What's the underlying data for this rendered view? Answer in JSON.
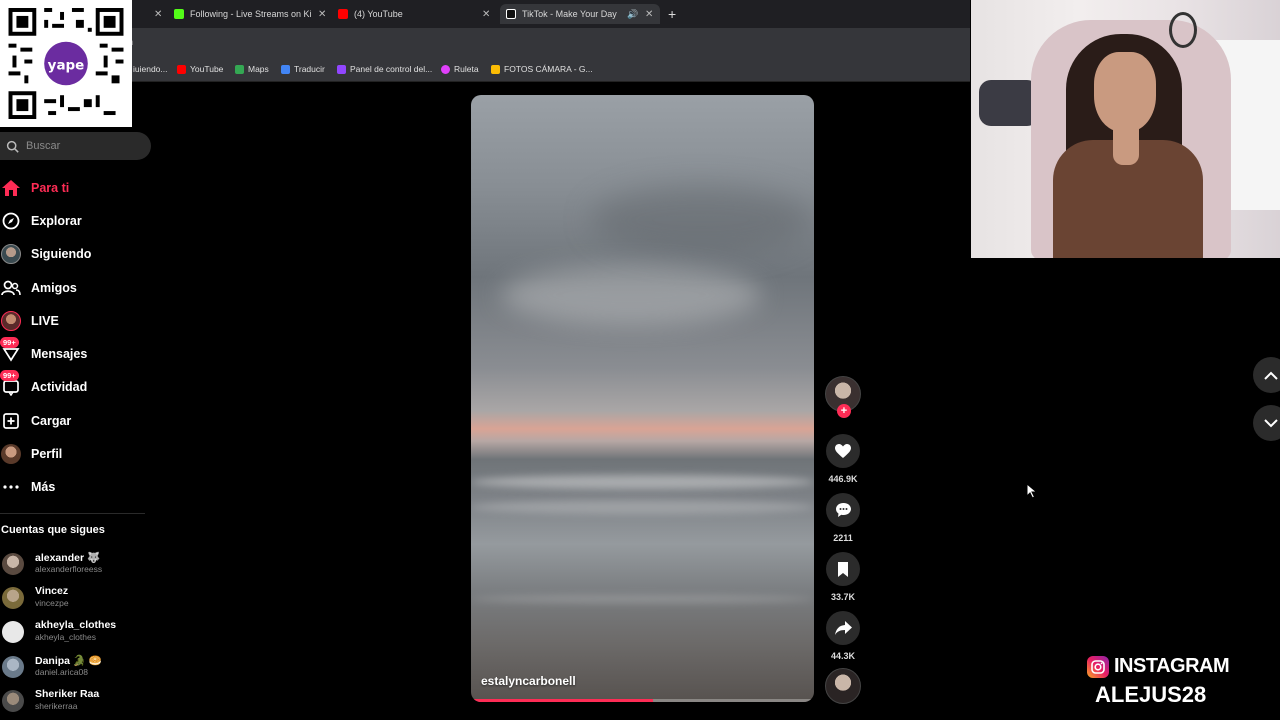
{
  "browser": {
    "tabs": [
      {
        "title": "",
        "icon": "tab-icon",
        "color": "#888888"
      },
      {
        "title": "Following - Live Streams on Ki",
        "icon": "kick-icon",
        "color": "#53fc18"
      },
      {
        "title": "(4) YouTube",
        "icon": "youtube-icon",
        "color": "#ff0000"
      },
      {
        "title": "TikTok - Make Your Day",
        "icon": "tiktok-icon",
        "color": "#ffffff"
      }
    ],
    "address_fragment": "n",
    "bookmarks": [
      {
        "label": "iuiendo...",
        "color": "#9146ff"
      },
      {
        "label": "YouTube",
        "color": "#ff0000"
      },
      {
        "label": "Maps",
        "color": "#34a853"
      },
      {
        "label": "Traducir",
        "color": "#4285f4"
      },
      {
        "label": "Panel de control del...",
        "color": "#9146ff"
      },
      {
        "label": "Ruleta",
        "color": "#e040fb"
      },
      {
        "label": "FOTOS CÁMARA - G...",
        "color": "#fbbc04"
      }
    ]
  },
  "sidebar": {
    "search_placeholder": "Buscar",
    "nav": [
      {
        "label": "Para ti",
        "icon": "home-icon",
        "active": true
      },
      {
        "label": "Explorar",
        "icon": "compass-icon"
      },
      {
        "label": "Siguiendo",
        "icon": "following-avatar-icon"
      },
      {
        "label": "Amigos",
        "icon": "friends-icon"
      },
      {
        "label": "LIVE",
        "icon": "live-avatar-icon"
      },
      {
        "label": "Mensajes",
        "icon": "messages-icon",
        "badge": "99+"
      },
      {
        "label": "Actividad",
        "icon": "activity-icon",
        "badge": "99+"
      },
      {
        "label": "Cargar",
        "icon": "upload-icon"
      },
      {
        "label": "Perfil",
        "icon": "profile-avatar-icon"
      },
      {
        "label": "Más",
        "icon": "more-icon"
      }
    ],
    "following_title": "Cuentas que sigues",
    "accounts": [
      {
        "name": "alexander 🐺",
        "handle": "alexanderfloreess",
        "color": "#5a4a40"
      },
      {
        "name": "Vincez",
        "handle": "vincezpe",
        "color": "#7a6a3a"
      },
      {
        "name": "akheyla_clothes",
        "handle": "akheyla_clothes",
        "color": "#e8e8e8"
      },
      {
        "name": "Danipa 🐊 🥯",
        "handle": "daniel.arica08",
        "color": "#6a7a8a"
      },
      {
        "name": "Sheriker Raa",
        "handle": "sherikerraa",
        "color": "#4a4a4a"
      }
    ]
  },
  "video": {
    "author": "estalyncarbonell",
    "progress": 0.53
  },
  "actions": {
    "likes": "446.9K",
    "comments": "2211",
    "saves": "33.7K",
    "shares": "44.3K"
  },
  "overlay": {
    "instagram_label": "INSTAGRAM",
    "instagram_handle": "ALEJUS28"
  }
}
